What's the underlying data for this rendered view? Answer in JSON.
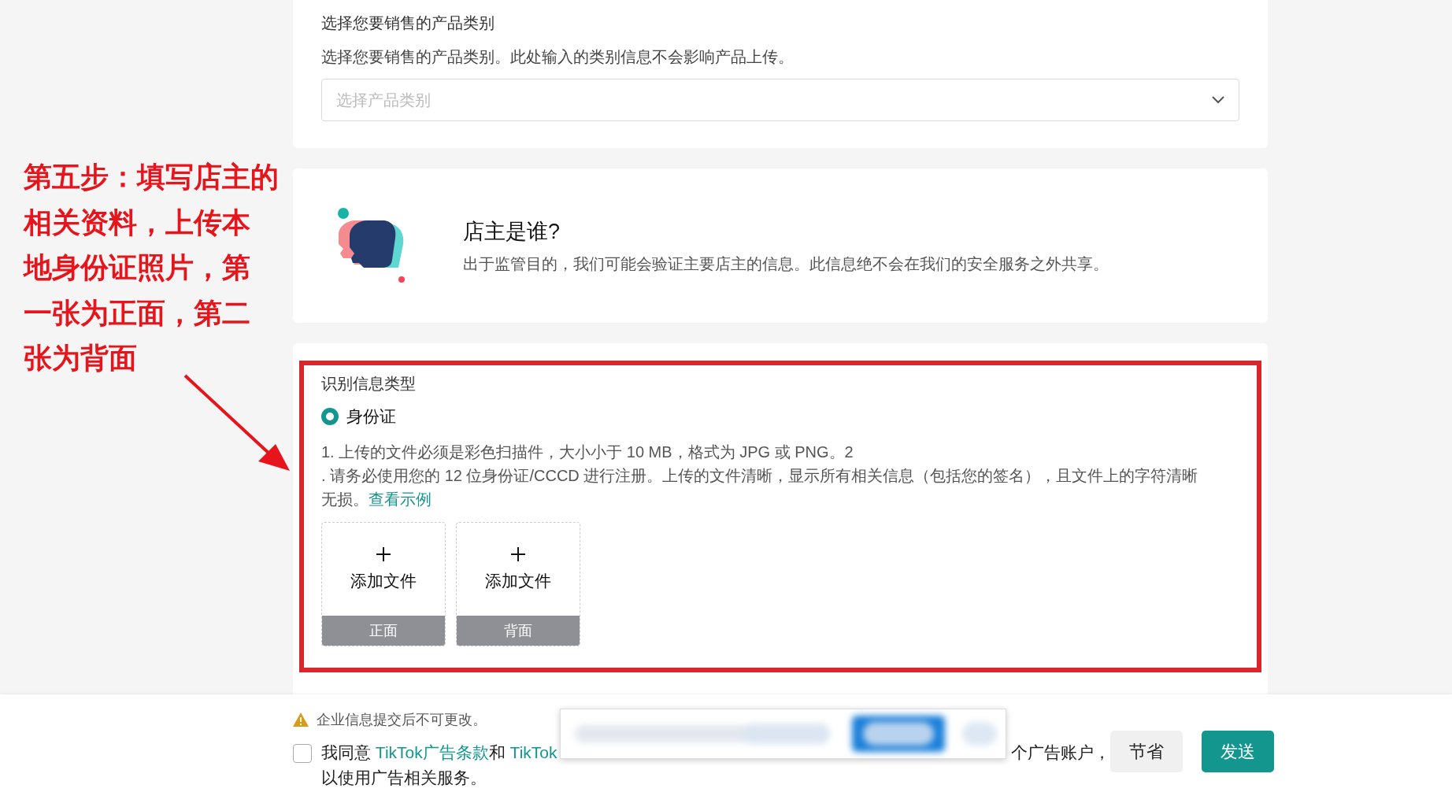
{
  "category_section": {
    "label": "选择您要销售的产品类别",
    "description": "选择您要销售的产品类别。此处输入的类别信息不会影响产品上传。",
    "select": {
      "placeholder": "选择产品类别"
    }
  },
  "owner_section": {
    "title": "店主是谁?",
    "description": "出于监管目的，我们可能会验证主要店主的信息。此信息绝不会在我们的安全服务之外共享。"
  },
  "id_section": {
    "label": "识别信息类型",
    "options": [
      {
        "label": "身份证",
        "selected": true
      }
    ],
    "requirements": [
      "1. 上传的文件必须是彩色扫描件，大小小于 10 MB，格式为 JPG 或 PNG。2",
      ". 请务必使用您的 12 位身份证/CCCD 进行注册。上传的文件清晰，显示所有相关信息（包括您的签名），且文件上的字符清晰无损。"
    ],
    "example_link": "查看示例",
    "uploads": [
      {
        "action": "添加文件",
        "side": "正面"
      },
      {
        "action": "添加文件",
        "side": "背面"
      }
    ]
  },
  "annotation": {
    "lines": [
      "第五步：填写店主的",
      "相关资料，上传本",
      "地身份证照片，第",
      "一张为正面，第二",
      "张为背面"
    ]
  },
  "footer": {
    "warning": "企业信息提交后不可更改。",
    "agreement": {
      "checked": false,
      "before": "我同意 ",
      "link_1": "TikTok广告条款",
      "middle": "和 ",
      "link_2": "TikTok",
      "after": "个广告账户，",
      "line_2": "以使用广告相关服务。"
    },
    "buttons": [
      {
        "label": "节省",
        "kind": "secondary"
      },
      {
        "label": "发送",
        "kind": "primary"
      }
    ]
  }
}
